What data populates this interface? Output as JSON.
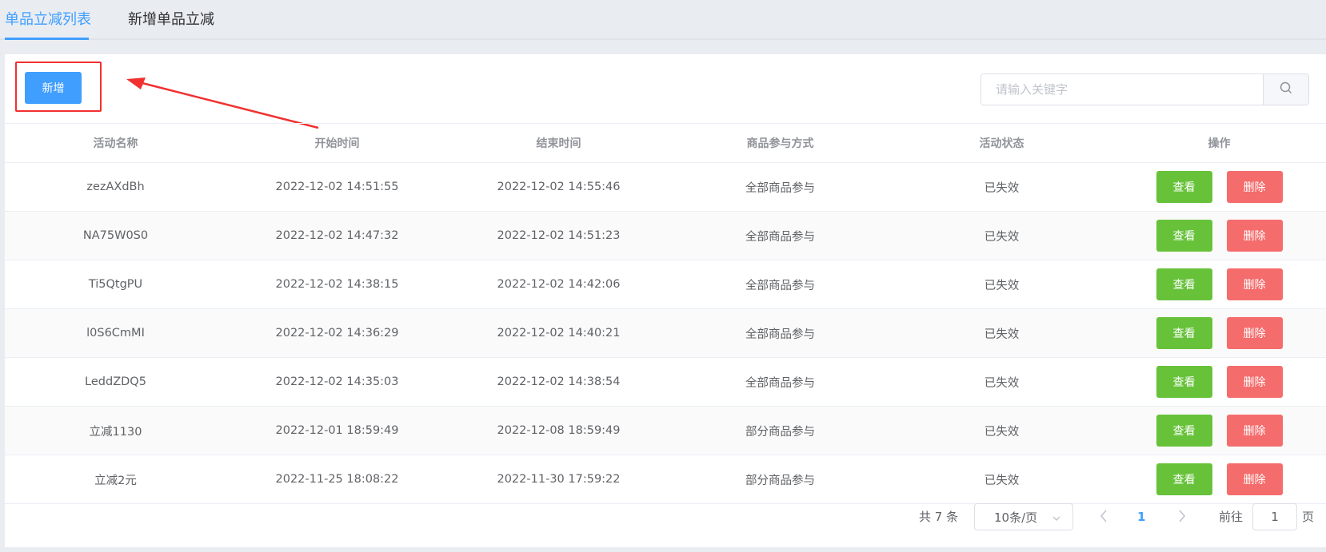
{
  "tabs": [
    {
      "label": "单品立减列表",
      "active": true
    },
    {
      "label": "新增单品立减",
      "active": false
    }
  ],
  "toolbar": {
    "add_label": "新增",
    "search_placeholder": "请输入关键字",
    "search_icon": "search-icon"
  },
  "annotation": {
    "color": "#f23030"
  },
  "table": {
    "headers": [
      "活动名称",
      "开始时间",
      "结束时间",
      "商品参与方式",
      "活动状态",
      "操作"
    ],
    "view_label": "查看",
    "delete_label": "删除",
    "rows": [
      {
        "name": "zezAXdBh",
        "start": "2022-12-02 14:51:55",
        "end": "2022-12-02 14:55:46",
        "mode": "全部商品参与",
        "status": "已失效"
      },
      {
        "name": "NA75W0S0",
        "start": "2022-12-02 14:47:32",
        "end": "2022-12-02 14:51:23",
        "mode": "全部商品参与",
        "status": "已失效"
      },
      {
        "name": "Ti5QtgPU",
        "start": "2022-12-02 14:38:15",
        "end": "2022-12-02 14:42:06",
        "mode": "全部商品参与",
        "status": "已失效"
      },
      {
        "name": "l0S6CmMI",
        "start": "2022-12-02 14:36:29",
        "end": "2022-12-02 14:40:21",
        "mode": "全部商品参与",
        "status": "已失效"
      },
      {
        "name": "LeddZDQ5",
        "start": "2022-12-02 14:35:03",
        "end": "2022-12-02 14:38:54",
        "mode": "全部商品参与",
        "status": "已失效"
      },
      {
        "name": "立减1130",
        "start": "2022-12-01 18:59:49",
        "end": "2022-12-08 18:59:49",
        "mode": "部分商品参与",
        "status": "已失效"
      },
      {
        "name": "立减2元",
        "start": "2022-11-25 18:08:22",
        "end": "2022-11-30 17:59:22",
        "mode": "部分商品参与",
        "status": "已失效"
      }
    ]
  },
  "pagination": {
    "total_label": "共 7 条",
    "page_size": "10条/页",
    "current_page": "1",
    "goto_label": "前往",
    "goto_value": "1",
    "page_label": "页"
  },
  "colors": {
    "primary": "#409eff",
    "success": "#67c23a",
    "danger": "#f56c6c"
  }
}
